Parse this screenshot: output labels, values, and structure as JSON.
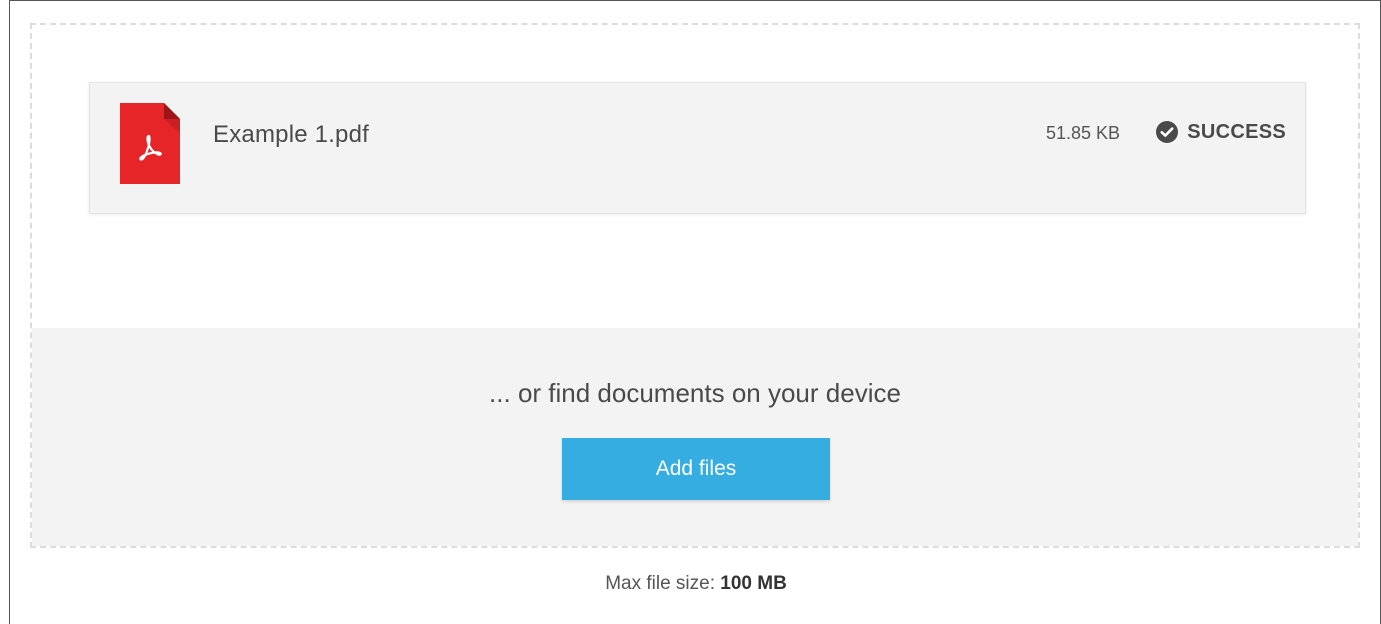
{
  "file": {
    "name": "Example 1.pdf",
    "size": "51.85 KB",
    "status": "SUCCESS",
    "icon": "pdf-file-icon"
  },
  "upload": {
    "device_text": "... or find documents on your device",
    "add_files_label": "Add files"
  },
  "limits": {
    "label": "Max file size: ",
    "value": "100 MB"
  },
  "colors": {
    "accent": "#36ade0",
    "pdf_red": "#e52528",
    "panel": "#f3f3f3"
  }
}
